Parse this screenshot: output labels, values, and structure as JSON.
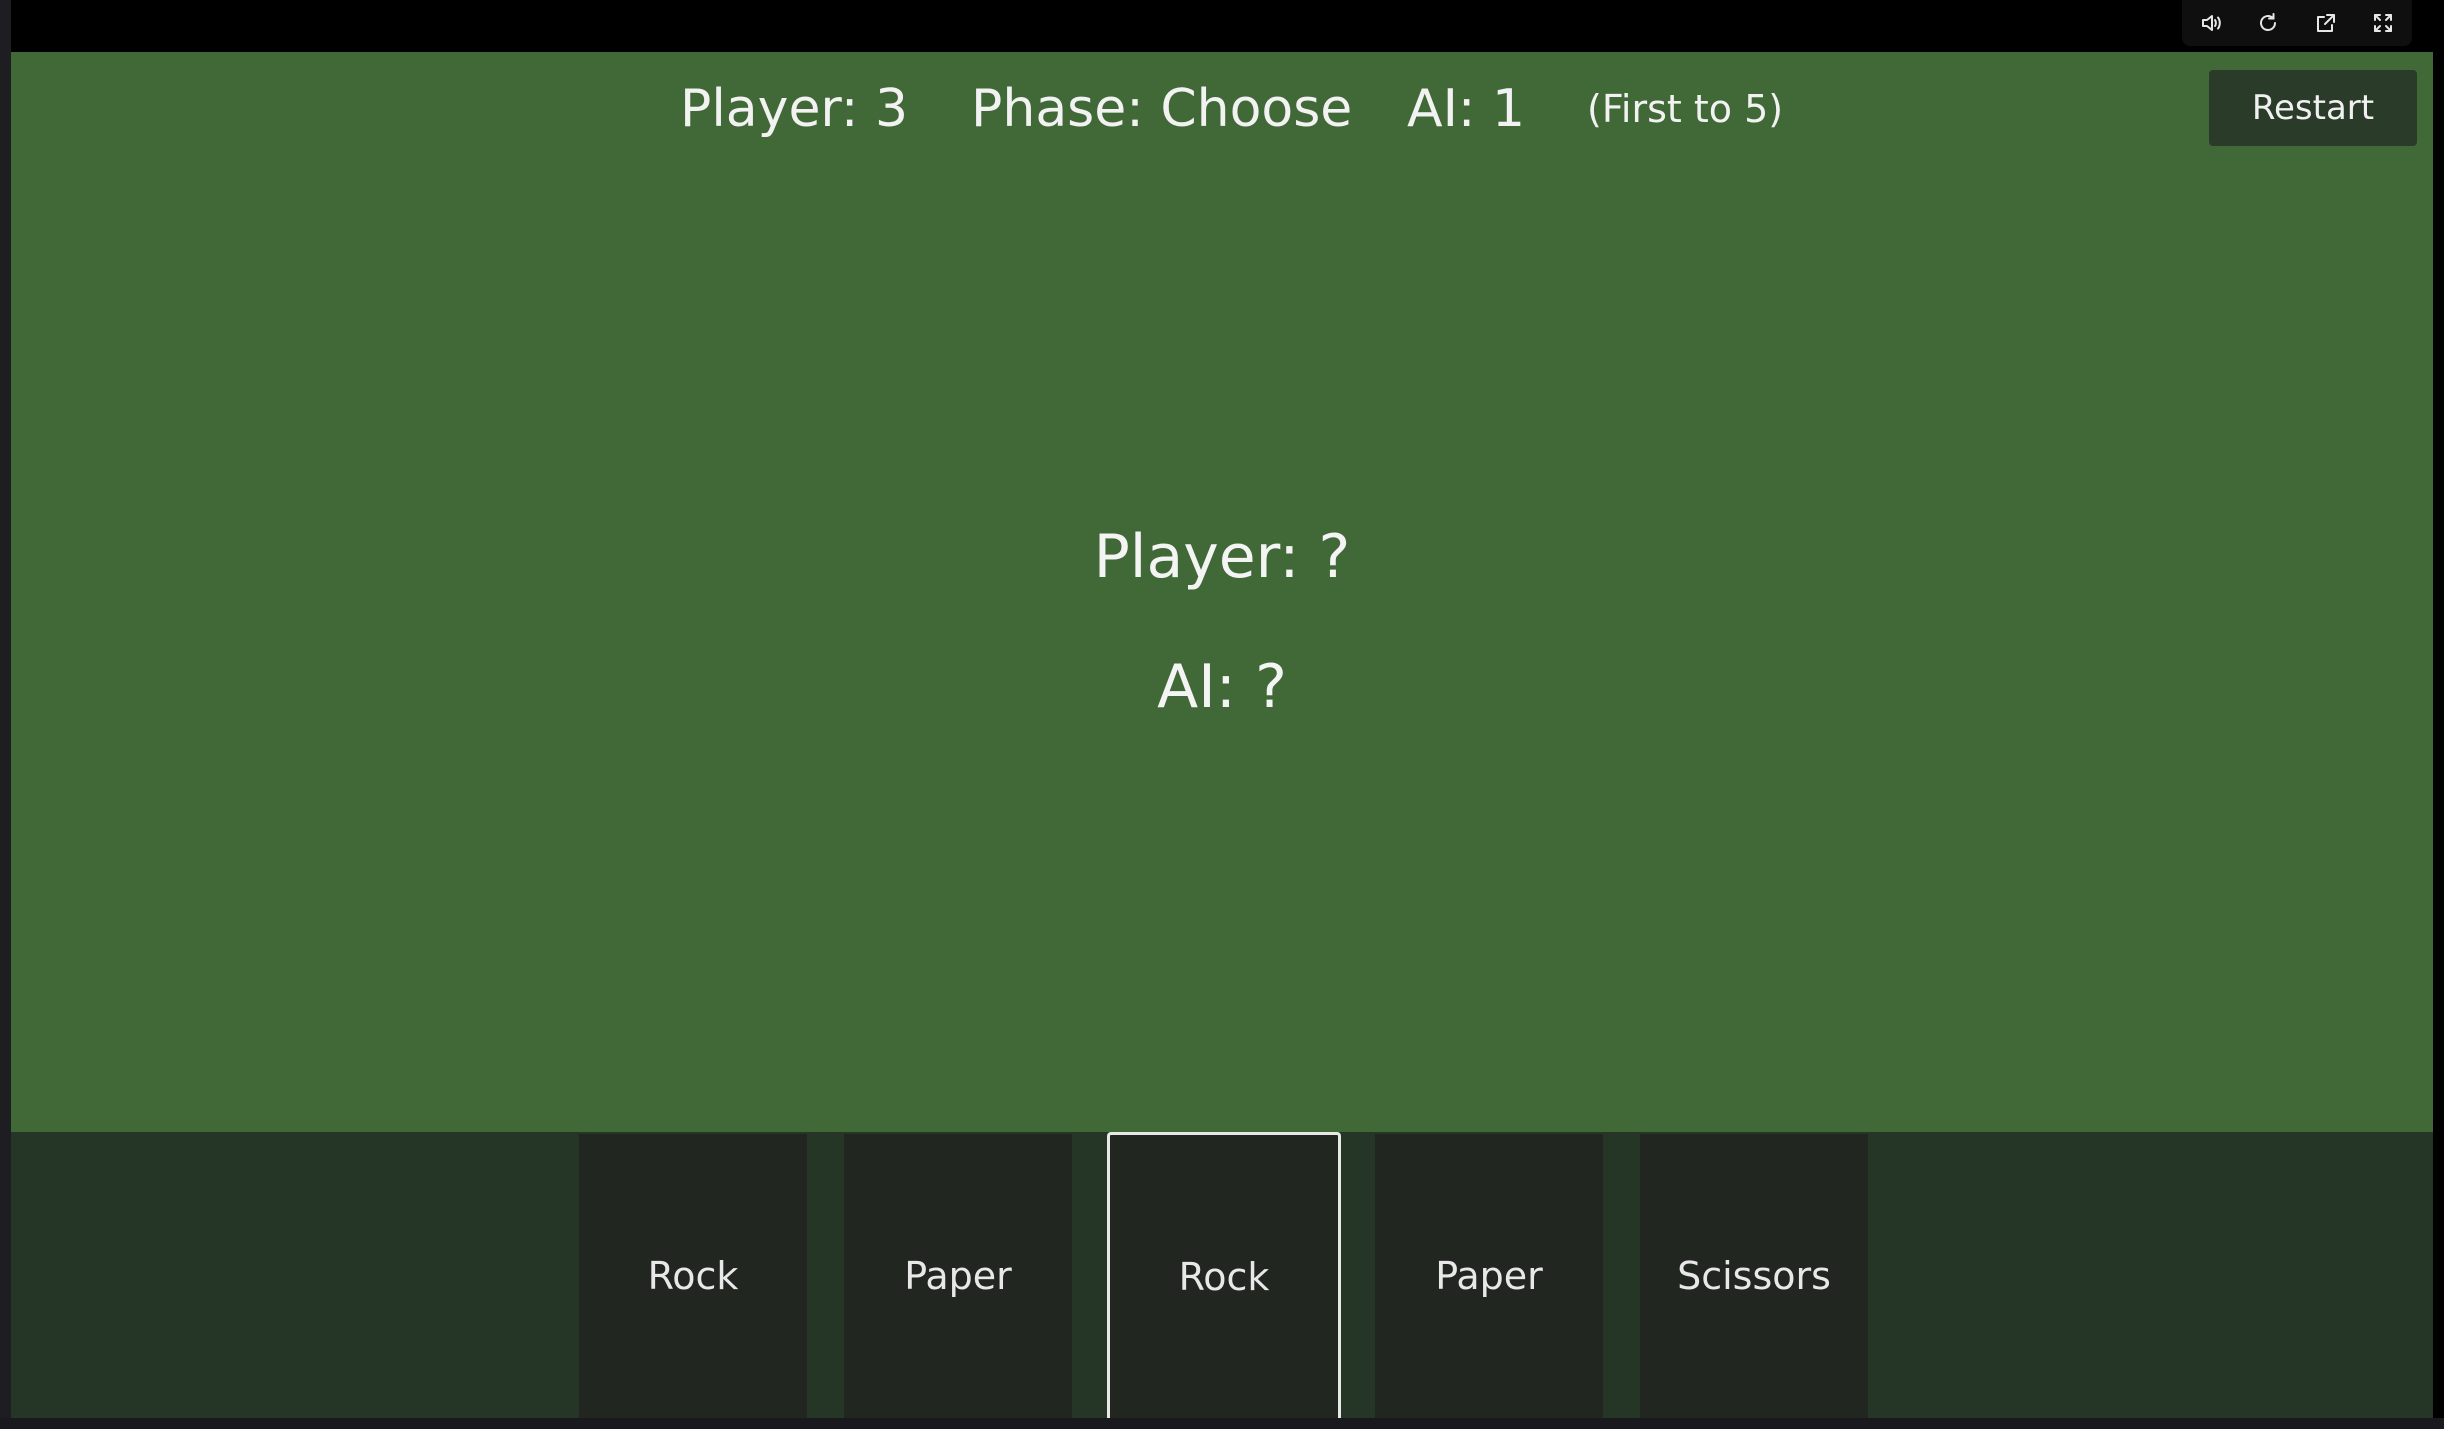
{
  "toolbar": {
    "icons": [
      "volume-icon",
      "reload-icon",
      "open-external-icon",
      "fullscreen-icon"
    ]
  },
  "hud": {
    "player_score": "Player: 3",
    "phase": "Phase: Choose",
    "ai_score": "AI: 1",
    "goal": "(First to 5)",
    "restart_label": "Restart"
  },
  "reveal": {
    "player_choice": "Player: ?",
    "ai_choice": "AI: ?"
  },
  "hand": {
    "cards": [
      {
        "label": "Rock",
        "selected": false
      },
      {
        "label": "Paper",
        "selected": false
      },
      {
        "label": "Rock",
        "selected": true
      },
      {
        "label": "Paper",
        "selected": false
      },
      {
        "label": "Scissors",
        "selected": false
      }
    ]
  },
  "colors": {
    "table_green": "#416937",
    "hand_area": "#263626",
    "card_bg": "#212621",
    "restart_bg": "#2b3b2a"
  }
}
